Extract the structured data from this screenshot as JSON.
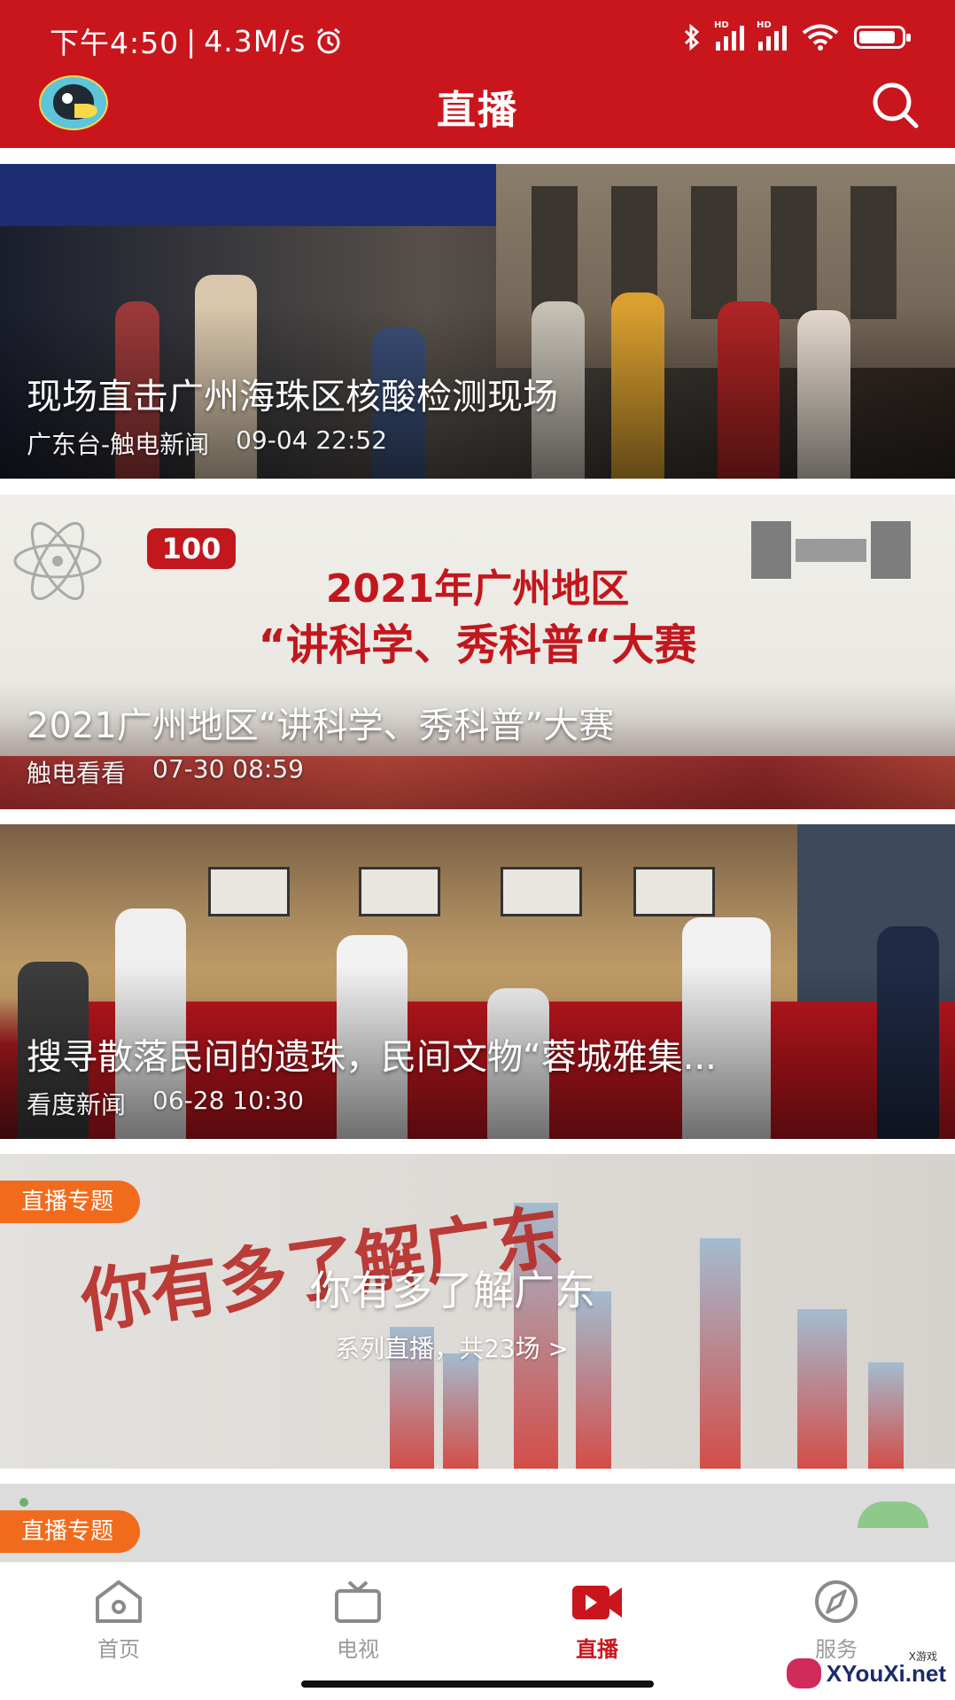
{
  "status_bar": {
    "time": "下午4:50",
    "speed": "4.3M/s",
    "hd1": "HD",
    "hd2": "HD"
  },
  "header": {
    "title": "直播"
  },
  "feed": [
    {
      "title": "现场直击广州海珠区核酸检测现场",
      "source": "广东台-触电新闻",
      "time": "09-04 22:52"
    },
    {
      "title": "2021广州地区“讲科学、秀科普”大赛",
      "source": "触电看看",
      "time": "07-30 08:59"
    },
    {
      "title": "搜寻散落民间的遗珠，民间文物“蓉城雅集...",
      "source": "看度新闻",
      "time": "06-28 10:30"
    }
  ],
  "poster": {
    "badge": "100",
    "line1": "2021年广州地区",
    "line2": "“讲科学、秀科普“大赛"
  },
  "topics": [
    {
      "tag": "直播专题",
      "brush": "你有多了解广东",
      "title": "你有多了解广东",
      "subtitle": "系列直播，共23场 >"
    },
    {
      "tag": "直播专题"
    }
  ],
  "tabbar": {
    "items": [
      {
        "label": "首页",
        "icon": "home-icon",
        "active": false
      },
      {
        "label": "电视",
        "icon": "tv-icon",
        "active": false
      },
      {
        "label": "直播",
        "icon": "video-camera-icon",
        "active": true
      },
      {
        "label": "服务",
        "icon": "compass-icon",
        "active": false
      }
    ]
  },
  "watermark": {
    "text": "XYouXi.net",
    "small": "X游戏"
  },
  "colors": {
    "brand_red": "#c9161d",
    "tag_orange": "#f26b1d",
    "tab_inactive": "#9a9a9a"
  }
}
